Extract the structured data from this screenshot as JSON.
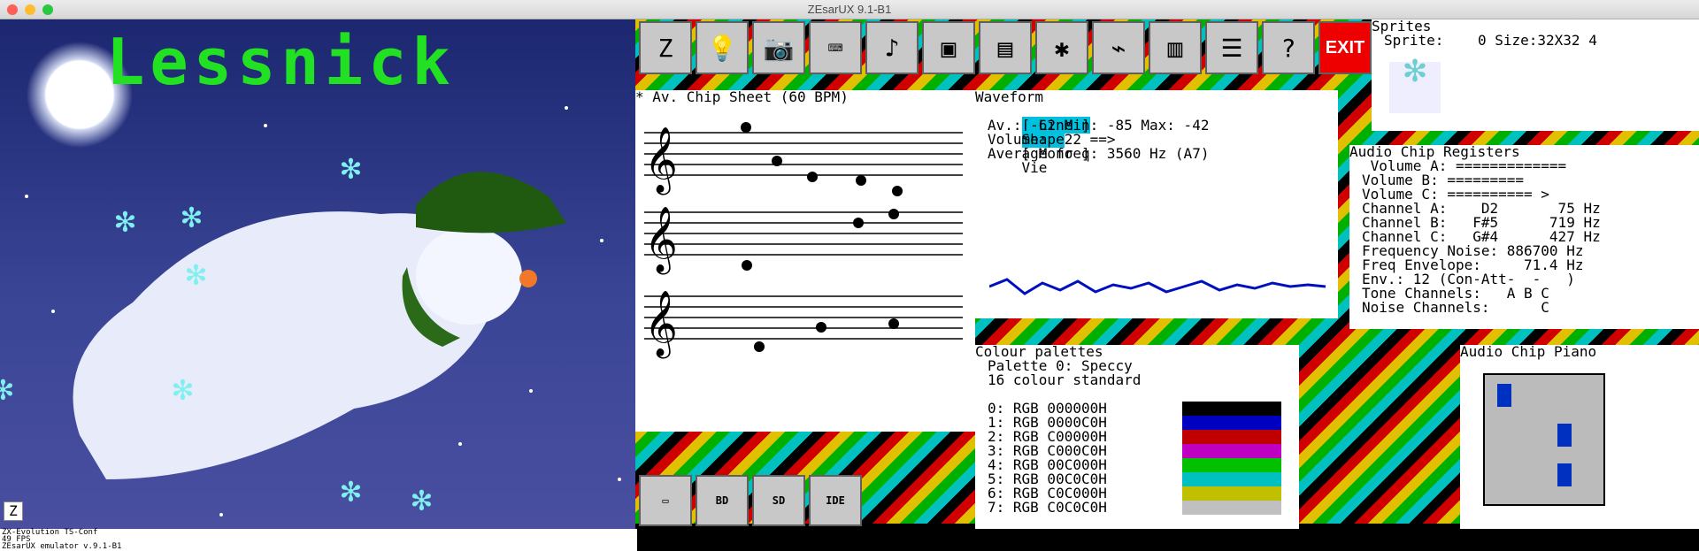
{
  "window": {
    "title": "ZEsarUX 9.1-B1"
  },
  "machine_text": {
    "logo": "Lessnick"
  },
  "status": [
    "ZX-Evolution TS-Conf",
    "49 FPS",
    "ZEsarUX emulator v.9.1-B1"
  ],
  "toolbar": {
    "icons": [
      "zesarux-logo-icon",
      "bulb-help-icon",
      "snapshot-camera-icon",
      "keyboard-help-icon",
      "music-note-icon",
      "display-icon",
      "storage-icon",
      "debug-bug-icon",
      "network-icon",
      "window-icon",
      "audio-mixer-icon",
      "help-question-icon"
    ],
    "exit_label": "EXIT"
  },
  "chip_sheet": {
    "title": "* Av. Chip Sheet (60 BPM)",
    "close": "/"
  },
  "waveform": {
    "title": "Waveform",
    "close": "/",
    "line_tab": "[ Line ]",
    "shape_tab": "Shape",
    "mono_tab": "[ Mono ]",
    "view_tab": "Vie",
    "av_line": "Av.: -62 Min: -85 Max: -42",
    "volume_line": "Volume:  22 ==>",
    "freq_line": "Average freq: 3560 Hz (A7)"
  },
  "sprites": {
    "title": "Sprites",
    "close": "/",
    "info_line": "Sprite:    0 Size:32X32 4"
  },
  "registers": {
    "title": "Audio Chip Registers",
    "close": "/",
    "rows": [
      " Volume A: =============",
      "Volume B: =========",
      "Volume C: ========== >",
      "Channel A:    D2       75 Hz",
      "Channel B:   F#5      719 Hz",
      "Channel C:   G#4      427 Hz",
      "Frequency Noise: 886700 Hz",
      "Freq Envelope:     71.4 Hz",
      "Env.: 12 (Con-Att-  -   )",
      "Tone Channels:   A B C",
      "Noise Channels:      C"
    ]
  },
  "palettes": {
    "title": "Colour palettes",
    "close": "/",
    "line1": "Palette 0: Speccy",
    "line2": "16 colour standard",
    "entries": [
      {
        "label": "0: RGB 000000H",
        "color": "#000000"
      },
      {
        "label": "1: RGB 0000C0H",
        "color": "#0000c0"
      },
      {
        "label": "2: RGB C00000H",
        "color": "#c00000"
      },
      {
        "label": "3: RGB C000C0H",
        "color": "#c000c0"
      },
      {
        "label": "4: RGB 00C000H",
        "color": "#00c000"
      },
      {
        "label": "5: RGB 00C0C0H",
        "color": "#00c0c0"
      },
      {
        "label": "6: RGB C0C000H",
        "color": "#c0c000"
      },
      {
        "label": "7: RGB C0C0C0H",
        "color": "#c0c0c0"
      }
    ]
  },
  "piano": {
    "title": "Audio Chip Piano",
    "close": "/"
  },
  "bottom_buttons": [
    "tape-icon",
    "BD",
    "SD",
    "IDE"
  ]
}
